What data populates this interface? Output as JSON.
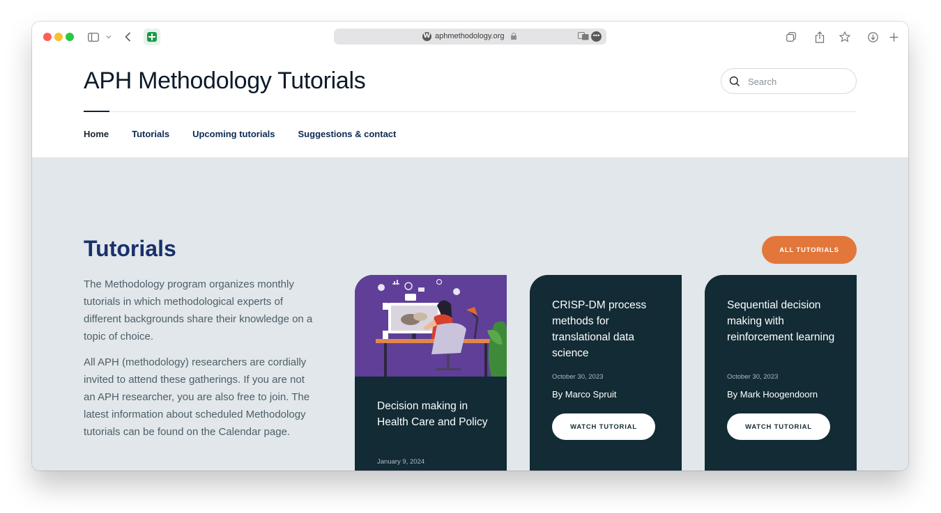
{
  "browser": {
    "url": "aphmethodology.org"
  },
  "site": {
    "title": "APH Methodology Tutorials"
  },
  "search": {
    "placeholder": "Search"
  },
  "nav": {
    "items": [
      {
        "label": "Home"
      },
      {
        "label": "Tutorials"
      },
      {
        "label": "Upcoming tutorials"
      },
      {
        "label": "Suggestions & contact"
      }
    ]
  },
  "tutorials": {
    "heading": "Tutorials",
    "all_button": "ALL TUTORIALS",
    "intro": [
      "The Methodology program organizes monthly tutorials in which methodological experts of different backgrounds share their knowledge on a topic of choice.",
      "All APH (methodology) researchers are cordially invited to attend these gatherings. If you are not an APH researcher, you are also free to join. The latest information about scheduled Methodology tutorials can be found on the Calendar page."
    ],
    "cards": [
      {
        "title": "Decision making in Health Care and Policy",
        "date": "January 9, 2024"
      },
      {
        "title": "CRISP-DM process methods for translational data science",
        "date": "October 30, 2023",
        "author": "By Marco Spruit",
        "button": "WATCH TUTORIAL"
      },
      {
        "title": "Sequential decision making with reinforcement learning",
        "date": "October 30, 2023",
        "author": "By Mark Hoogendoorn",
        "button": "WATCH TUTORIAL"
      }
    ]
  },
  "colors": {
    "accent_orange": "#e3763b",
    "card_dark": "#122b34",
    "heading_blue": "#1a2f6b",
    "section_bg": "#e1e7ea"
  }
}
